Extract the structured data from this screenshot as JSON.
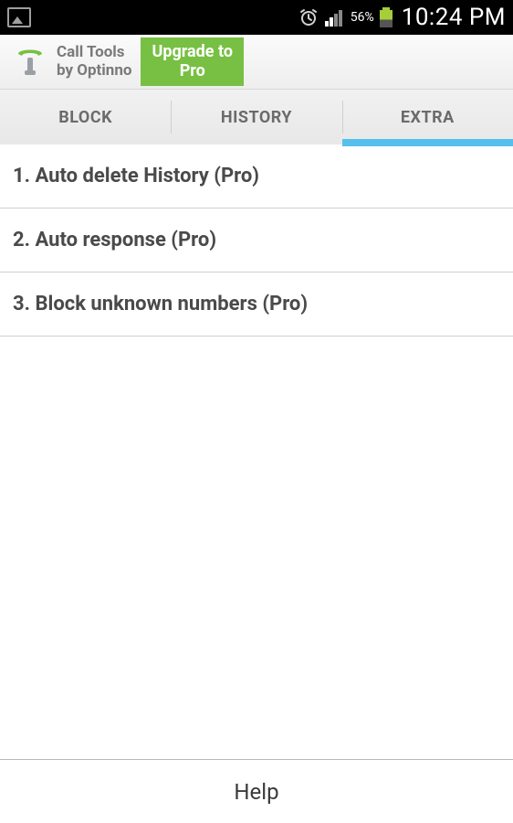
{
  "status": {
    "battery_pct": "56%",
    "time": "10:24 PM"
  },
  "header": {
    "title_line1": "Call Tools",
    "title_line2": "by Optinno",
    "upgrade_line1": "Upgrade to",
    "upgrade_line2": "Pro"
  },
  "tabs": {
    "items": [
      {
        "label": "BLOCK"
      },
      {
        "label": "HISTORY"
      },
      {
        "label": "EXTRA"
      }
    ],
    "active_index": 2
  },
  "list": {
    "items": [
      {
        "label": "1. Auto delete History (Pro)"
      },
      {
        "label": "2. Auto response (Pro)"
      },
      {
        "label": "3. Block unknown numbers (Pro)"
      }
    ]
  },
  "footer": {
    "help_label": "Help"
  },
  "colors": {
    "accent_green": "#77c043",
    "tab_indicator": "#55c0ee"
  }
}
